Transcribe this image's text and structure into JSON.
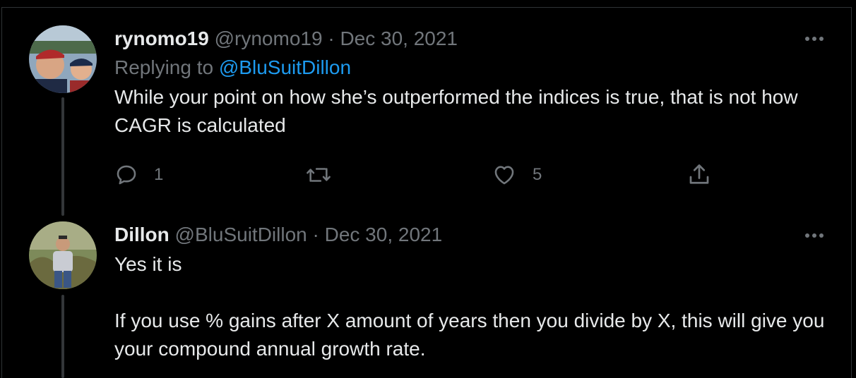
{
  "tweets": [
    {
      "display_name": "rynomo19",
      "handle": "@rynomo19",
      "separator": "·",
      "date": "Dec 30, 2021",
      "replying_to_label": "Replying to",
      "replying_to_handle": "@BluSuitDillon",
      "text": "While your point on how she’s outperformed the indices is true, that is not how CAGR is calculated",
      "avatar_icon": "avatar-photo-two-people-baseball-caps",
      "actions": {
        "reply_count": "1",
        "retweet_count": "",
        "like_count": "5"
      }
    },
    {
      "display_name": "Dillon",
      "handle": "@BluSuitDillon",
      "separator": "·",
      "date": "Dec 30, 2021",
      "text": "Yes it is\n\nIf you use % gains after X amount of years then you divide by X, this will give you your compound annual growth rate.",
      "avatar_icon": "avatar-photo-man-in-field"
    }
  ],
  "colors": {
    "background": "#000000",
    "text_primary": "#e7e9ea",
    "text_secondary": "#71767b",
    "link": "#1d9bf0",
    "thread_line": "#333639"
  }
}
